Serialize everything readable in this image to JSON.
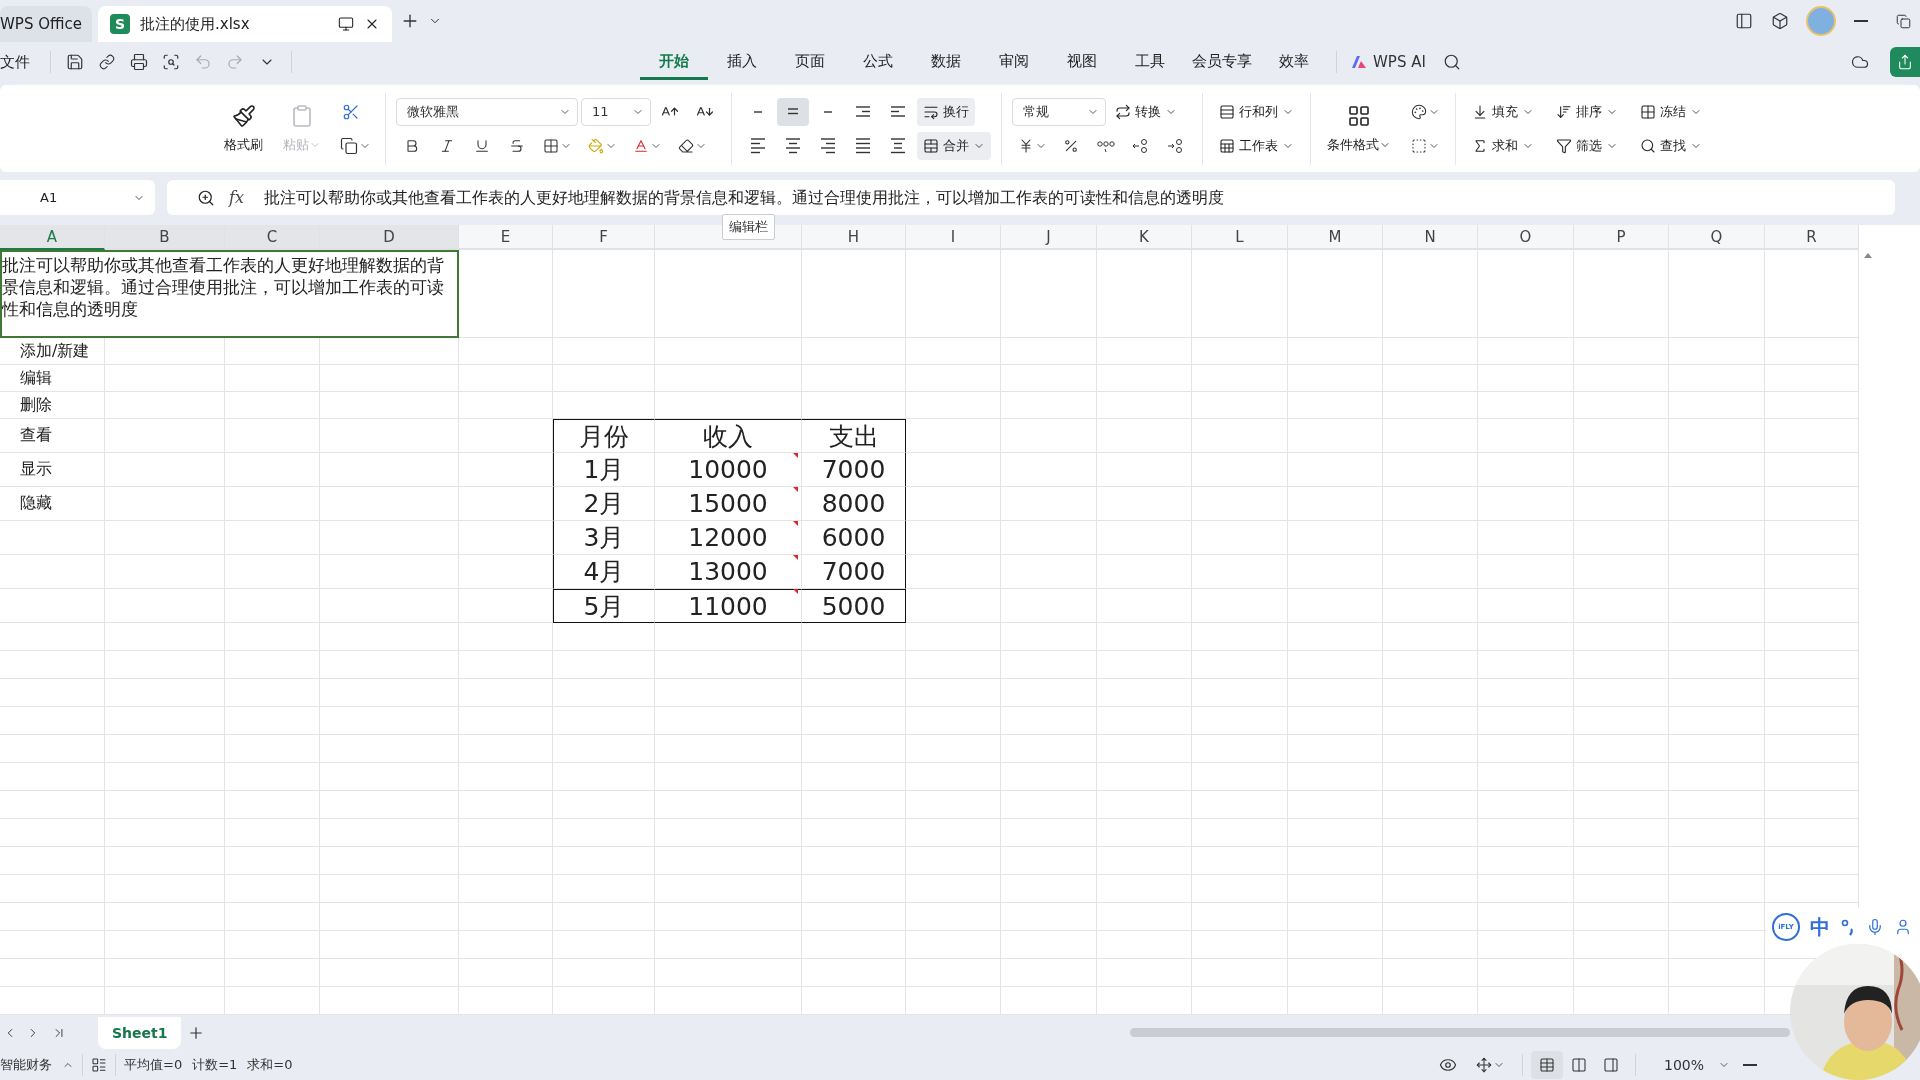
{
  "tabs": [
    {
      "label": "WPS Office",
      "kind": "home",
      "selected": false
    },
    {
      "label": "批注的使用.xlsx",
      "badge": "S",
      "kind": "file",
      "selected": true
    }
  ],
  "file_menu": "文件",
  "menu": [
    {
      "label": "开始",
      "selected": true
    },
    {
      "label": "插入",
      "selected": false
    },
    {
      "label": "页面",
      "selected": false
    },
    {
      "label": "公式",
      "selected": false
    },
    {
      "label": "数据",
      "selected": false
    },
    {
      "label": "审阅",
      "selected": false
    },
    {
      "label": "视图",
      "selected": false
    },
    {
      "label": "工具",
      "selected": false
    },
    {
      "label": "会员专享",
      "selected": false
    },
    {
      "label": "效率",
      "selected": false
    }
  ],
  "ai_label": "WPS AI",
  "ribbon": {
    "format_painter": "格式刷",
    "paste": {
      "label": "粘贴",
      "disabled": true
    },
    "font": {
      "name": "微软雅黑",
      "size": "11"
    },
    "vertical_align": [
      {
        "selected": false
      },
      {
        "selected": true
      },
      {
        "selected": false
      }
    ],
    "wrap": "换行",
    "merge": "合并",
    "number_format": "常规",
    "convert": "转换",
    "rows_cols": "行和列",
    "worksheet": "工作表",
    "cond_format": "条件格式",
    "edit_tools": [
      {
        "label": "填充"
      },
      {
        "label": "排序"
      },
      {
        "label": "冻结"
      },
      {
        "label": "求和"
      },
      {
        "label": "筛选"
      },
      {
        "label": "查找"
      }
    ]
  },
  "formula_bar": {
    "name_box": "A1",
    "fx_label": "fx",
    "formula": "批注可以帮助你或其他查看工作表的人更好地理解数据的背景信息和逻辑。通过合理使用批注，可以增加工作表的可读性和信息的透明度"
  },
  "tooltip": "编辑栏",
  "sheet": {
    "columns": [
      {
        "label": "A",
        "selected": true,
        "in_selection": true
      },
      {
        "label": "B",
        "selected": false,
        "in_selection": true
      },
      {
        "label": "C",
        "selected": false,
        "in_selection": true
      },
      {
        "label": "D",
        "selected": false,
        "in_selection": true
      },
      {
        "label": "E",
        "selected": false,
        "in_selection": false
      },
      {
        "label": "F",
        "selected": false,
        "in_selection": false
      },
      {
        "selected": false,
        "in_selection": false
      },
      {
        "label": "H",
        "selected": false,
        "in_selection": false
      },
      {
        "label": "I",
        "selected": false,
        "in_selection": false
      },
      {
        "label": "J",
        "selected": false,
        "in_selection": false
      },
      {
        "label": "K",
        "selected": false,
        "in_selection": false
      },
      {
        "label": "L",
        "selected": false,
        "in_selection": false
      },
      {
        "label": "M",
        "selected": false,
        "in_selection": false
      },
      {
        "label": "N",
        "selected": false,
        "in_selection": false
      },
      {
        "label": "O",
        "selected": false,
        "in_selection": false
      },
      {
        "label": "P",
        "selected": false,
        "in_selection": false
      },
      {
        "label": "Q",
        "selected": false,
        "in_selection": false
      },
      {
        "label": "R",
        "selected": false,
        "in_selection": false
      }
    ],
    "a1": "批注可以帮助你或其他查看工作表的人更好地理解数据的背景信息和逻辑。通过合理使用批注，可以增加工作表的可读性和信息的透明度",
    "list": [
      "添加/新建",
      "编辑",
      "删除",
      "查看",
      "显示",
      "隐藏"
    ],
    "table": {
      "header": [
        "月份",
        "收入",
        "支出"
      ],
      "rows": [
        {
          "cells": [
            "1月",
            "10000",
            "7000"
          ],
          "has_comment": true
        },
        {
          "cells": [
            "2月",
            "15000",
            "8000"
          ],
          "has_comment": true
        },
        {
          "cells": [
            "3月",
            "12000",
            "6000"
          ],
          "has_comment": true
        },
        {
          "cells": [
            "4月",
            "13000",
            "7000"
          ],
          "has_comment": true
        },
        {
          "cells": [
            "5月",
            "11000",
            "5000"
          ],
          "has_comment": true
        }
      ]
    }
  },
  "sheet_tabs": [
    {
      "label": "Sheet1",
      "selected": true
    }
  ],
  "status": {
    "finance": "智能财务",
    "stats": [
      "平均值=0",
      "计数=1",
      "求和=0"
    ],
    "views": [
      {
        "selected": true
      },
      {
        "selected": false
      },
      {
        "selected": false
      }
    ],
    "zoom": "100%"
  },
  "ime_bar": {
    "badge": "iFLY",
    "mode": "中"
  }
}
